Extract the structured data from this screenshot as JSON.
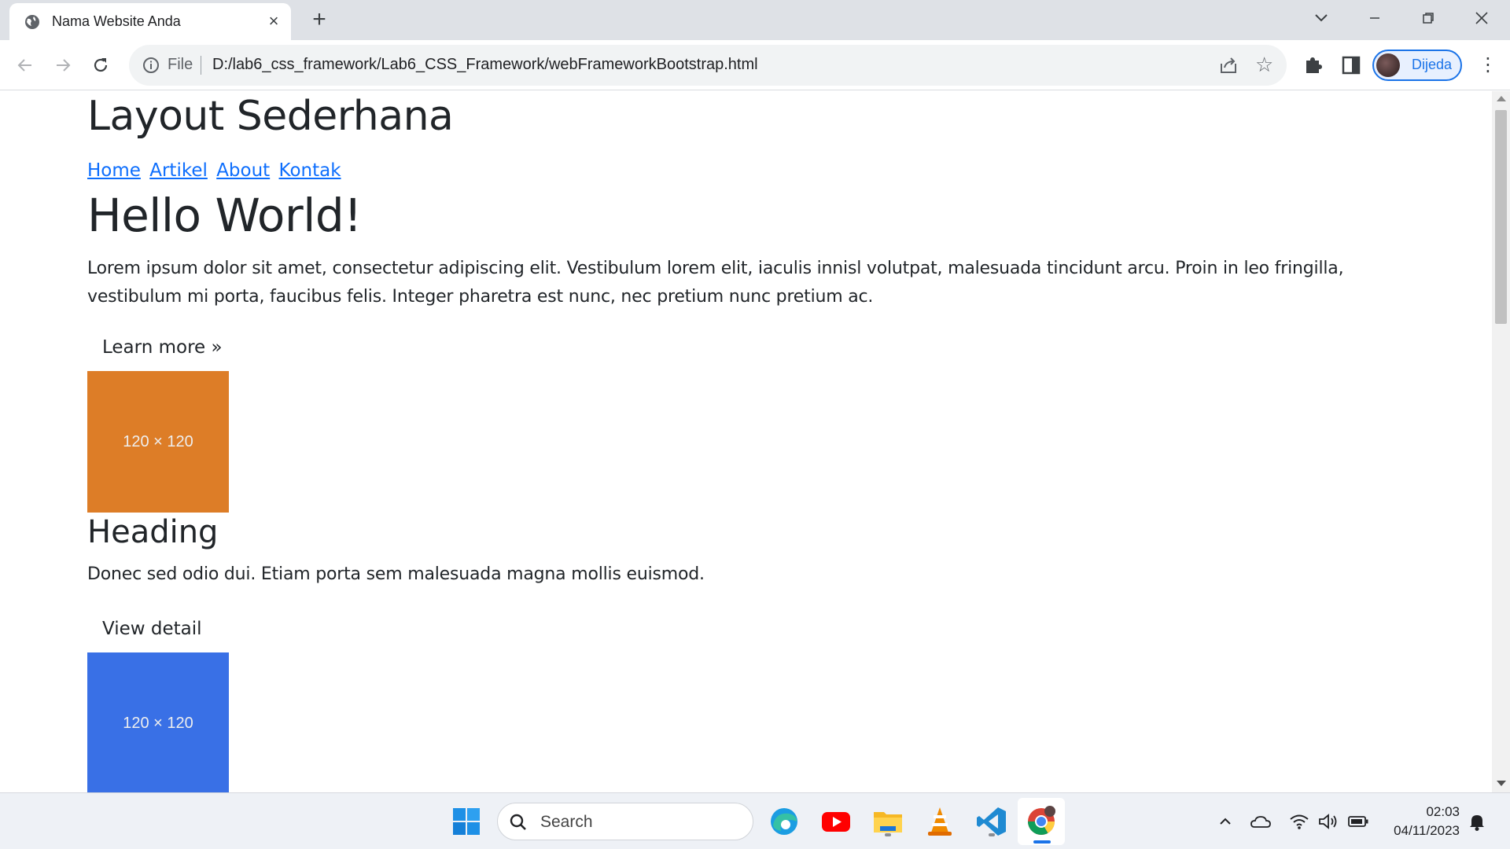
{
  "browser": {
    "tab_title": "Nama Website Anda",
    "new_tab_label": "+",
    "address_scheme": "File",
    "address_url": "D:/lab6_css_framework/Lab6_CSS_Framework/webFrameworkBootstrap.html",
    "profile_name": "Dijeda"
  },
  "page": {
    "site_title": "Layout Sederhana",
    "nav": [
      "Home",
      "Artikel",
      "About",
      "Kontak"
    ],
    "hero_title": "Hello World!",
    "hero_text": "Lorem ipsum dolor sit amet, consectetur adipiscing elit. Vestibulum lorem elit, iaculis innisl volutpat, malesuada tincidunt arcu. Proin in leo fringilla, vestibulum mi porta, faucibus felis. Integer pharetra est nunc, nec pretium nunc pretium ac.",
    "hero_button": "Learn more »",
    "placeholder_label": "120 × 120",
    "card_heading": "Heading",
    "card_text": "Donec sed odio dui. Etiam porta sem malesuada magna mollis euismod.",
    "card_button": "View detail",
    "colors": {
      "thumb1": "#dd7d27",
      "thumb2": "#3970e6",
      "link": "#0d6efd"
    }
  },
  "taskbar": {
    "search_label": "Search",
    "time": "02:03",
    "date": "04/11/2023",
    "apps": [
      "start-icon",
      "edge-icon",
      "youtube-icon",
      "file-explorer-icon",
      "vlc-icon",
      "vscode-icon",
      "chrome-icon"
    ]
  }
}
